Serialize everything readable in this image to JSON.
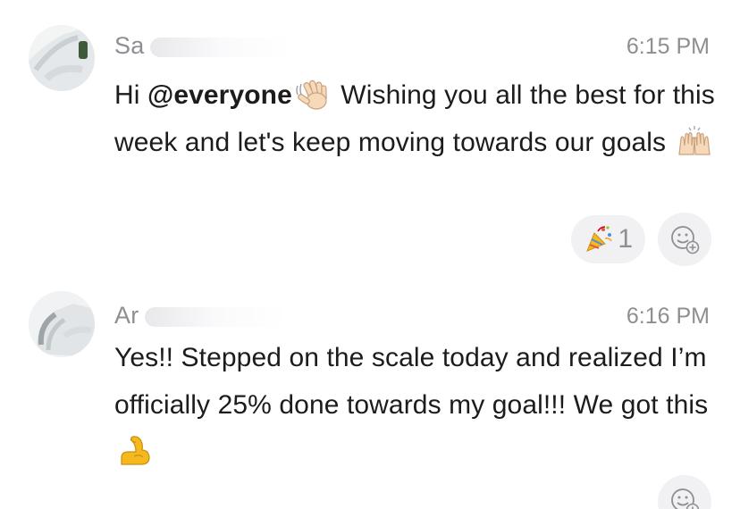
{
  "messages": [
    {
      "sender": "Sa",
      "time": "6:15 PM",
      "lines": {
        "greeting": "Hi ",
        "mention": "@everyone",
        "after_wave": " Wishing you all the best for this week and let's keep moving towards our goals "
      },
      "reactions": [
        {
          "icon": "party-popper-icon",
          "count": "1"
        }
      ]
    },
    {
      "sender": "Ar",
      "time": "6:16 PM",
      "lines": {
        "text": "Yes!! Stepped on the scale today and realized I’m officially 25% done towards my goal!!! We got this "
      }
    }
  ],
  "icons": {
    "wave": "waving-hand-icon",
    "raised_hands": "raised-hands-icon",
    "flexed_biceps": "flexed-biceps-icon",
    "add_reaction": "add-reaction-icon"
  },
  "colors": {
    "text": "#1c1c1e",
    "meta": "#8e8e93",
    "pill_bg": "#f1f1f3",
    "emoji_skin": "#f6d9b8",
    "emoji_yellow": "#f5b81f"
  }
}
